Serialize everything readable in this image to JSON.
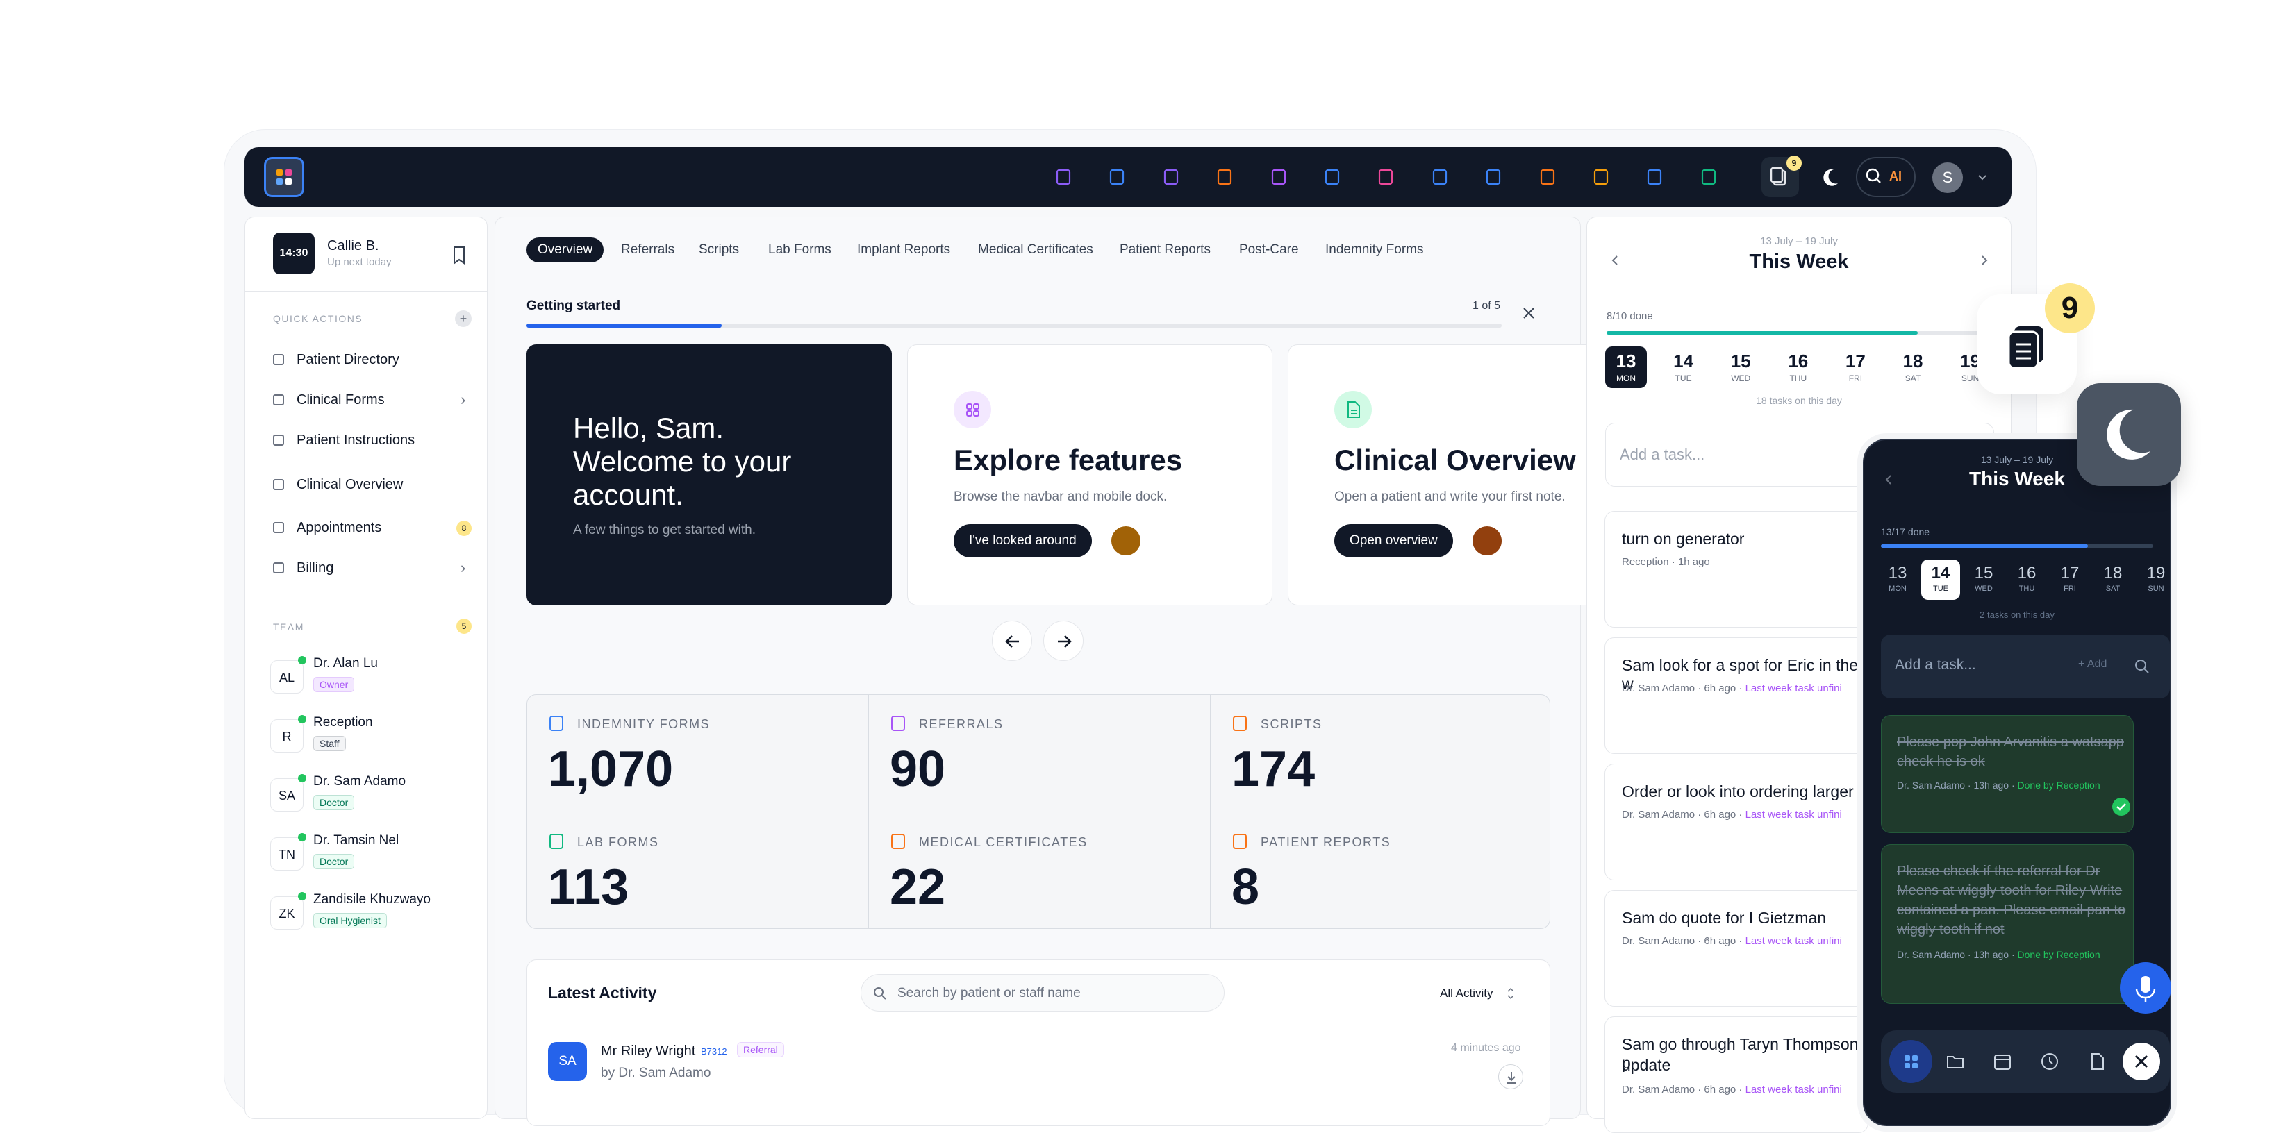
{
  "colors": {
    "accent": "#2563eb",
    "dark": "#111827",
    "online": "#22c55e",
    "badge_yellow": "#fde68a",
    "purple": "#a855f7"
  },
  "topbar": {
    "notif_count": "9",
    "ai_label": "AI",
    "avatar_letter": "S",
    "dock_icons": [
      "presentation-icon",
      "folder-icon",
      "edit-icon",
      "file-icon",
      "files-icon",
      "box-icon",
      "copy-icon",
      "send-icon",
      "book-icon",
      "chart-icon",
      "clock-icon",
      "calendar-icon",
      "money-icon"
    ]
  },
  "sidebar": {
    "time": "14:30",
    "user_name": "Callie B.",
    "user_sub": "Up next today",
    "quick_actions_label": "QUICK ACTIONS",
    "items": [
      {
        "label": "Patient Directory",
        "icon": "folder-icon"
      },
      {
        "label": "Clinical Forms",
        "icon": "file-icon",
        "chevron": true
      },
      {
        "label": "Patient Instructions",
        "icon": "book-icon"
      },
      {
        "label": "Clinical Overview",
        "icon": "clock-icon"
      },
      {
        "label": "Appointments",
        "icon": "calendar-icon",
        "count": "8"
      },
      {
        "label": "Billing",
        "icon": "money-icon",
        "chevron": true
      }
    ],
    "team_label": "TEAM",
    "team_count": "5",
    "team": [
      {
        "initials": "AL",
        "name": "Dr. Alan Lu",
        "role": "Owner"
      },
      {
        "initials": "R",
        "name": "Reception",
        "role": "Staff"
      },
      {
        "initials": "SA",
        "name": "Dr. Sam Adamo",
        "role": "Doctor"
      },
      {
        "initials": "TN",
        "name": "Dr. Tamsin Nel",
        "role": "Doctor"
      },
      {
        "initials": "ZK",
        "name": "Zandisile Khuzwayo",
        "role": "Oral Hygienist"
      }
    ]
  },
  "main": {
    "tabs": [
      "Overview",
      "Referrals",
      "Scripts",
      "Lab Forms",
      "Implant Reports",
      "Medical Certificates",
      "Patient Reports",
      "Post-Care",
      "Indemnity Forms"
    ],
    "getting_started": "Getting started",
    "progress_text": "1 of 5",
    "progress_fraction": 0.2,
    "cards": [
      {
        "title": "Hello, Sam. Welcome to your account.",
        "sub": "A few things to get started with."
      },
      {
        "title": "Explore features",
        "sub": "Browse the navbar and mobile dock.",
        "button": "I've looked around"
      },
      {
        "title": "Clinical Overview",
        "sub": "Open a patient and write your first note.",
        "button": "Open overview"
      }
    ],
    "stats": [
      {
        "label": "INDEMNITY FORMS",
        "value": "1,070",
        "color": "#3b82f6"
      },
      {
        "label": "REFERRALS",
        "value": "90",
        "color": "#a855f7"
      },
      {
        "label": "SCRIPTS",
        "value": "174",
        "color": "#f97316"
      },
      {
        "label": "LAB FORMS",
        "value": "113",
        "color": "#10b981"
      },
      {
        "label": "MEDICAL CERTIFICATES",
        "value": "22",
        "color": "#f97316"
      },
      {
        "label": "PATIENT REPORTS",
        "value": "8",
        "color": "#f97316"
      }
    ],
    "activity": {
      "title": "Latest Activity",
      "search_placeholder": "Search by patient or staff name",
      "filter": "All Activity",
      "row": {
        "initials": "SA",
        "name": "Mr Riley Wright",
        "code": "B7312",
        "tag": "Referral",
        "by": "by Dr. Sam Adamo",
        "time": "4 minutes ago"
      }
    }
  },
  "week": {
    "range": "13 July – 19 July",
    "title": "This Week",
    "done_text": "8/10 done",
    "progress_fraction": 0.8,
    "days": [
      {
        "d": "13",
        "w": "MON"
      },
      {
        "d": "14",
        "w": "TUE"
      },
      {
        "d": "15",
        "w": "WED"
      },
      {
        "d": "16",
        "w": "THU"
      },
      {
        "d": "17",
        "w": "FRI"
      },
      {
        "d": "18",
        "w": "SAT"
      },
      {
        "d": "19",
        "w": "SUN"
      }
    ],
    "tasks_count": "18 tasks on this day",
    "add_placeholder": "Add a task...",
    "tasks": [
      {
        "title": "turn on generator",
        "meta": "Reception · 1h ago",
        "tag": ""
      },
      {
        "title": "Sam look for a spot for Eric in the w",
        "meta": "Dr. Sam Adamo · 6h ago · ",
        "tag": "Last week task unfini"
      },
      {
        "title": "Order or look into ordering larger c",
        "meta": "Dr. Sam Adamo · 6h ago · ",
        "tag": "Last week task unfini"
      },
      {
        "title": "Sam do quote for I Gietzman",
        "meta": "Dr. Sam Adamo · 6h ago · ",
        "tag": "Last week task unfini"
      },
      {
        "title": "Sam go through Taryn Thompson p",
        "title2": "update",
        "meta": "Dr. Sam Adamo · 6h ago · ",
        "tag": "Last week task unfini"
      }
    ]
  },
  "float": {
    "count": "9"
  },
  "mobile": {
    "range": "13 July – 19 July",
    "title": "This Week",
    "done_text": "13/17 done",
    "progress_fraction": 0.76,
    "days": [
      {
        "d": "13",
        "w": "MON"
      },
      {
        "d": "14",
        "w": "TUE"
      },
      {
        "d": "15",
        "w": "WED"
      },
      {
        "d": "16",
        "w": "THU"
      },
      {
        "d": "17",
        "w": "FRI"
      },
      {
        "d": "18",
        "w": "SAT"
      },
      {
        "d": "19",
        "w": "SUN"
      }
    ],
    "tasks_count": "2 tasks on this day",
    "add_placeholder": "Add a task...",
    "add_label": "+ Add",
    "tasks": [
      {
        "title": "Please pop John Arvanitis a watsapp check he is ok",
        "meta": "Dr. Sam Adamo · 13h ago · ",
        "status": "Done by Reception"
      },
      {
        "title": "Please check if the referral for Dr Meens at wiggly tooth for Riley Write contained a pan. Please email pan to wiggly tooth if not",
        "meta": "Dr. Sam Adamo · 13h ago · ",
        "status": "Done by Reception"
      }
    ]
  }
}
